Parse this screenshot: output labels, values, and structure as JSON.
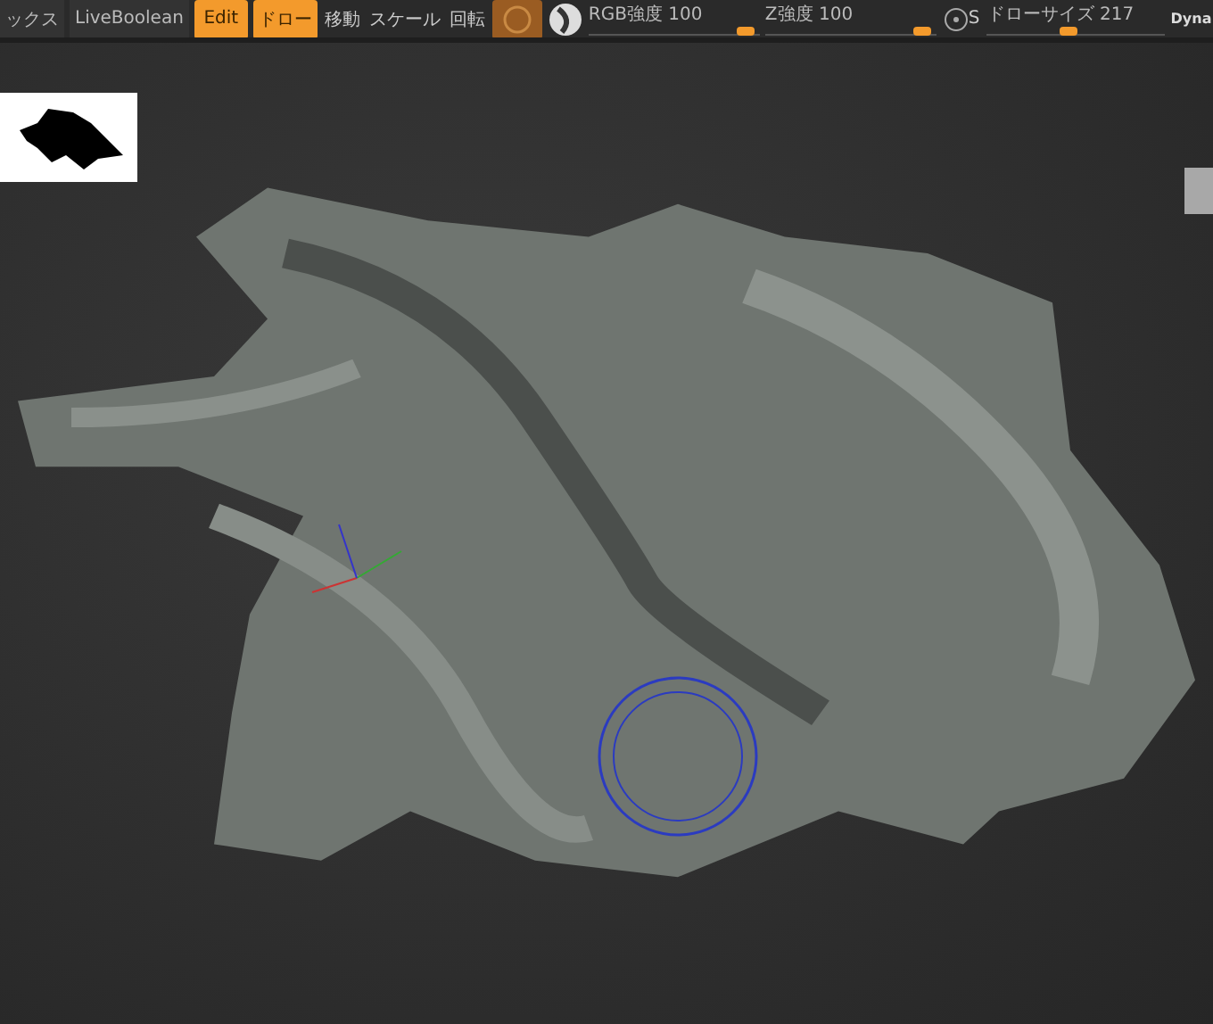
{
  "toolbar": {
    "left_labels": [
      "ックス",
      "LiveBoolean"
    ],
    "mode_buttons": [
      {
        "label": "Edit",
        "selected": true
      },
      {
        "label": "ドロー",
        "selected": true
      }
    ],
    "transform_buttons": [
      {
        "label": "移動",
        "selected": false
      },
      {
        "label": "スケール",
        "selected": false
      },
      {
        "label": "回転",
        "selected": false
      }
    ],
    "sliders": [
      {
        "label": "RGB強度",
        "reading": "100",
        "level": 0.97
      },
      {
        "label": "Z強度",
        "reading": "100",
        "level": 0.97
      },
      {
        "label": "ドローサイズ",
        "reading": "217",
        "level": 0.45
      }
    ],
    "symmetry_key": "S",
    "cut_label": "Dyna"
  }
}
